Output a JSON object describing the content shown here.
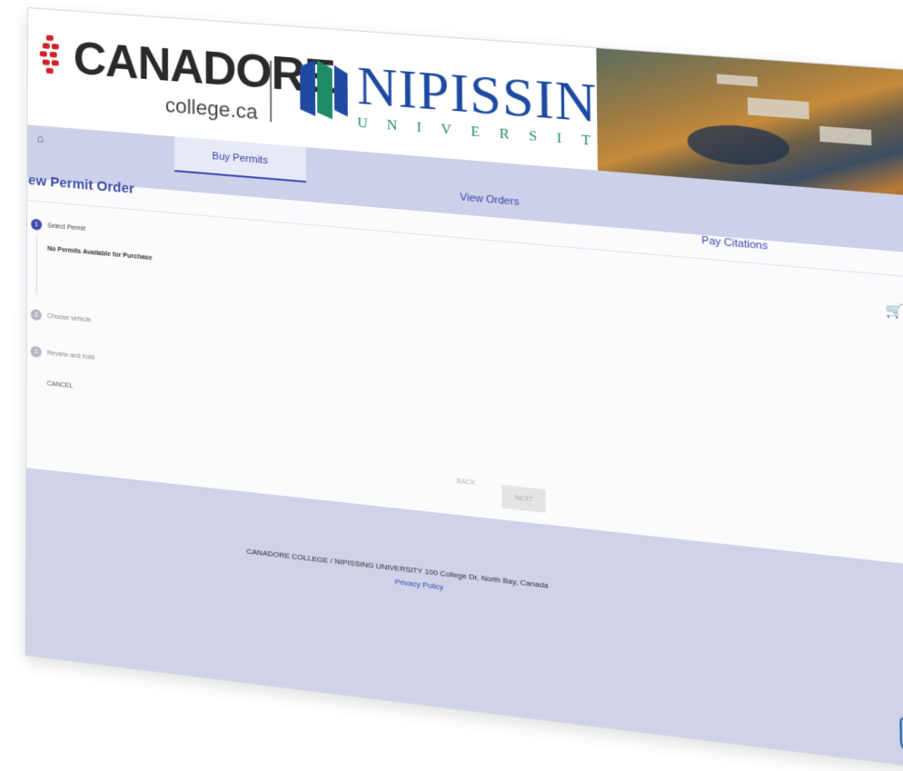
{
  "branding": {
    "canadore_name": "CANADORE",
    "canadore_domain": "college.ca",
    "nipissing_name": "NIPISSING",
    "nipissing_sub": "UNIVERSITY"
  },
  "nav": {
    "home_icon": "home-icon",
    "tabs": [
      {
        "label": "Buy Permits",
        "active": true
      },
      {
        "label": "View Orders",
        "active": false
      },
      {
        "label": "Pay Citations",
        "active": false
      }
    ],
    "user_icon": "user-icon"
  },
  "page": {
    "title": "New Permit Order",
    "steps": [
      {
        "number": "1",
        "label": "Select Permit",
        "active": true
      },
      {
        "number": "2",
        "label": "Choose vehicle",
        "active": false
      },
      {
        "number": "3",
        "label": "Review and hold",
        "active": false
      }
    ],
    "no_permits": "No Permits Available for Purchase",
    "cancel_label": "CANCEL",
    "back_label": "BACK",
    "next_label": "NEXT"
  },
  "icons": {
    "cart": "cart-icon",
    "close": "close-icon",
    "shield": "shield-check-icon"
  },
  "footer": {
    "address": "CANADORE COLLEGE / NIPISSING UNIVERSITY 100 College Dr, North Bay, Canada",
    "privacy_label": "Privacy Policy"
  },
  "colors": {
    "accent": "#3e4bb4",
    "nav_bg": "#ccd0e8",
    "footer_bg": "#cfd2e8",
    "success": "#53b34b"
  }
}
